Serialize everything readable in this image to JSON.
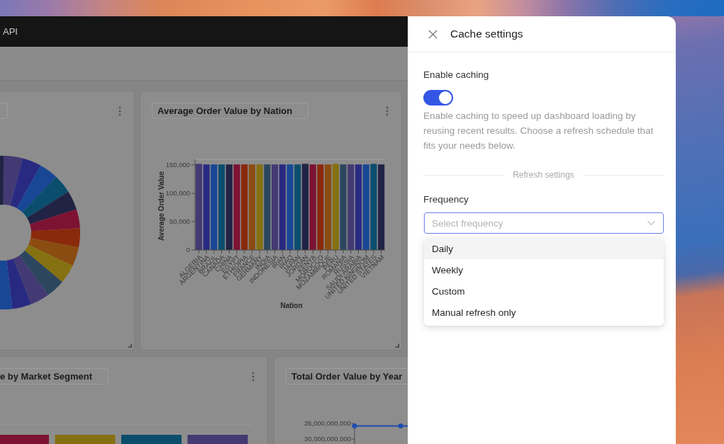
{
  "dashboard": {
    "header": {
      "nav_link": "API"
    },
    "cards": [
      {
        "kind": "donut"
      },
      {
        "kind": "bar_chart",
        "title": "Average Order Value by Nation",
        "chart_data": {
          "type": "bar",
          "xlabel": "Nation",
          "ylabel": "Average Order Value",
          "categories": [
            "ALGERIA",
            "ARGENTINA",
            "BRAZIL",
            "CANADA",
            "CHINA",
            "EGYPT",
            "ETHIOPIA",
            "FRANCE",
            "GERMANY",
            "INDIA",
            "INDONESIA",
            "IRAN",
            "IRAQ",
            "JAPAN",
            "JORDAN",
            "KENYA",
            "MOROCCO",
            "MOZAMBIQUE",
            "PERU",
            "ROMANIA",
            "RUSSIA",
            "SAUDI ARABIA",
            "UNITED KINGDOM",
            "UNITED STATES",
            "VIETNAM"
          ],
          "values": [
            152000,
            151000,
            151000,
            151000,
            151000,
            151000,
            151000,
            151000,
            151000,
            151000,
            151000,
            151000,
            151000,
            151000,
            152000,
            151000,
            151000,
            151000,
            152000,
            151000,
            151000,
            151000,
            151000,
            152000,
            151000
          ],
          "ylim": [
            0,
            160000
          ],
          "yticks": [
            {
              "value": 0,
              "label": "0"
            },
            {
              "value": 50000,
              "label": "50,000"
            },
            {
              "value": 100000,
              "label": "100,000"
            },
            {
              "value": 150000,
              "label": "150,000"
            }
          ]
        }
      },
      {
        "kind": "segment_bars",
        "title": "e by Market Segment"
      },
      {
        "kind": "line_chart",
        "title": "Total Order Value by Year",
        "axis_labels": [
          "35,000,000,000",
          "30,000,000,000"
        ]
      }
    ]
  },
  "cache_settings": {
    "title": "Cache settings",
    "enable_label": "Enable caching",
    "caching_enabled": true,
    "description": "Enable caching to speed up dashboard loading by reusing recent results. Choose a refresh schedule that fits your needs below.",
    "section_divider": "Refresh settings",
    "frequency": {
      "label": "Frequency",
      "placeholder": "Select frequency",
      "expanded": true,
      "options": [
        {
          "label": "Daily",
          "highlighted": true
        },
        {
          "label": "Weekly",
          "highlighted": false
        },
        {
          "label": "Custom",
          "highlighted": false
        },
        {
          "label": "Manual refresh only",
          "highlighted": false
        }
      ]
    }
  }
}
